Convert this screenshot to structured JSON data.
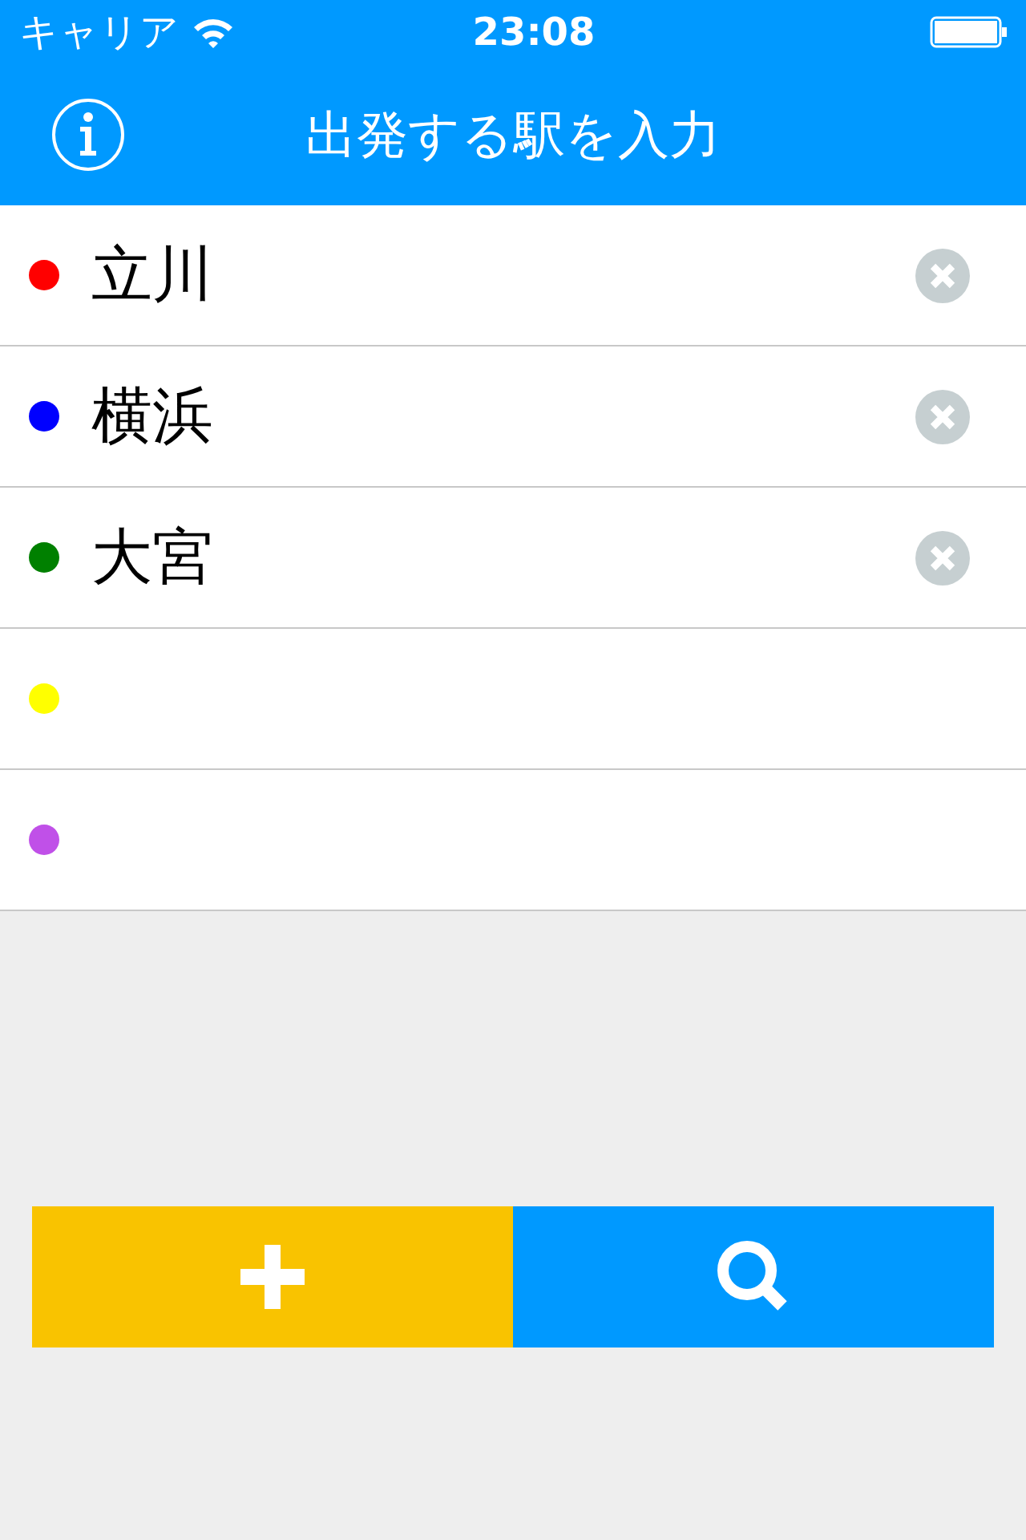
{
  "status_bar": {
    "carrier": "キャリア",
    "time": "23:08"
  },
  "nav_bar": {
    "title": "出発する駅を入力"
  },
  "stations": [
    {
      "name": "立川",
      "color": "#ff0000",
      "clear_button": true
    },
    {
      "name": "横浜",
      "color": "#0000ff",
      "clear_button": true
    },
    {
      "name": "大宮",
      "color": "#008000",
      "clear_button": true
    },
    {
      "color": "#ffff00",
      "clear_button": false
    },
    {
      "color": "#c050e8",
      "clear_button": false
    }
  ]
}
